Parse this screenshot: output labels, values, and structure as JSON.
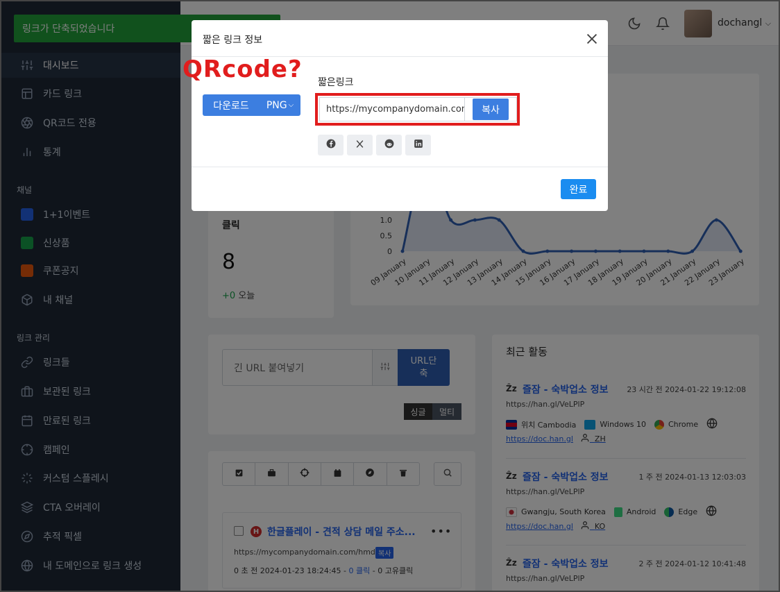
{
  "toast": "링크가 단축되었습니다",
  "sidebar": {
    "main": [
      {
        "label": "대시보드",
        "icon": "sliders-icon"
      },
      {
        "label": "카드 링크",
        "icon": "layout-icon"
      },
      {
        "label": "QR코드 전용",
        "icon": "aperture-icon"
      },
      {
        "label": "통계",
        "icon": "bar-chart-icon"
      }
    ],
    "channel_title": "채널",
    "channels": [
      {
        "label": "1+1이벤트",
        "color": "#2563eb"
      },
      {
        "label": "신상품",
        "color": "#16a34a"
      },
      {
        "label": "쿠폰공지",
        "color": "#ea580c"
      },
      {
        "label": "내 채널",
        "icon": "box-icon"
      }
    ],
    "manage_title": "링크 관리",
    "manage": [
      {
        "label": "링크들",
        "icon": "link-icon"
      },
      {
        "label": "보관된 링크",
        "icon": "briefcase-icon"
      },
      {
        "label": "만료된 링크",
        "icon": "calendar-icon"
      },
      {
        "label": "캠페인",
        "icon": "crosshair-icon"
      },
      {
        "label": "커스텀 스플레시",
        "icon": "loader-icon"
      },
      {
        "label": "CTA 오버레이",
        "icon": "layers-icon"
      },
      {
        "label": "추적 픽셀",
        "icon": "compass-icon"
      },
      {
        "label": "내 도메인으로 링크 생성",
        "icon": "globe-icon"
      }
    ]
  },
  "header": {
    "username": "dochangl"
  },
  "clicks": {
    "label": "클릭",
    "count": "8",
    "delta": "+0",
    "today": "오늘"
  },
  "chart_data": {
    "type": "area",
    "categories": [
      "09 January",
      "10 January",
      "11 January",
      "12 January",
      "13 January",
      "14 January",
      "15 January",
      "16 January",
      "17 January",
      "18 January",
      "19 January",
      "20 January",
      "21 January",
      "22 January",
      "23 January"
    ],
    "values": [
      0,
      3,
      1,
      1,
      1,
      0,
      0,
      0,
      0,
      0,
      0,
      0,
      0,
      1,
      0
    ],
    "y_ticks": [
      "0",
      "0.5",
      "1.0"
    ],
    "ylim": [
      0,
      1.5
    ],
    "color": "#2f5fb3"
  },
  "shorten": {
    "placeholder": "긴 URL 붙여넣기",
    "button": "URL단축",
    "single": "싱글",
    "multi": "멀티"
  },
  "link_item": {
    "title": "한글플레이 - 견적 상담 메일 주소...",
    "url": "https://mycompanydomain.com/hmdy5",
    "copy": "복사",
    "meta_prefix": "0 초 전 2024-01-23 18:24:45 - ",
    "clicks": "0 클릭",
    "unique": " - 0 고유클릭"
  },
  "activity": {
    "title": "최근 활동",
    "items": [
      {
        "title": "즐잠 - 숙박업소 정보",
        "time": "23 시간 전 2024-01-22 19:12:08",
        "url": "https://han.gl/VeLPlP",
        "location": "위치 Cambodia",
        "os": "Windows 10",
        "browser": "Chrome",
        "referrer": "https://doc.han.gl",
        "lang": "ZH"
      },
      {
        "title": "즐잠 - 숙박업소 정보",
        "time": "1 주 전 2024-01-13 12:03:03",
        "url": "https://han.gl/VeLPlP",
        "location": "Gwangju, South Korea",
        "os": "Android",
        "browser": "Edge",
        "referrer": "https://doc.han.gl",
        "lang": "KO"
      },
      {
        "title": "즐잠 - 숙박업소 정보",
        "time": "2 주 전 2024-01-12 10:41:48",
        "url": "https://han.gl/VeLPlP"
      }
    ]
  },
  "modal": {
    "title": "짧은 링크 정보",
    "annotation": "QRcode?",
    "download": "다운로드",
    "format": "PNG",
    "short_label": "짧은링크",
    "short_url": "https://mycompanydomain.com/hmdy5",
    "copy": "복사",
    "done": "완료"
  }
}
